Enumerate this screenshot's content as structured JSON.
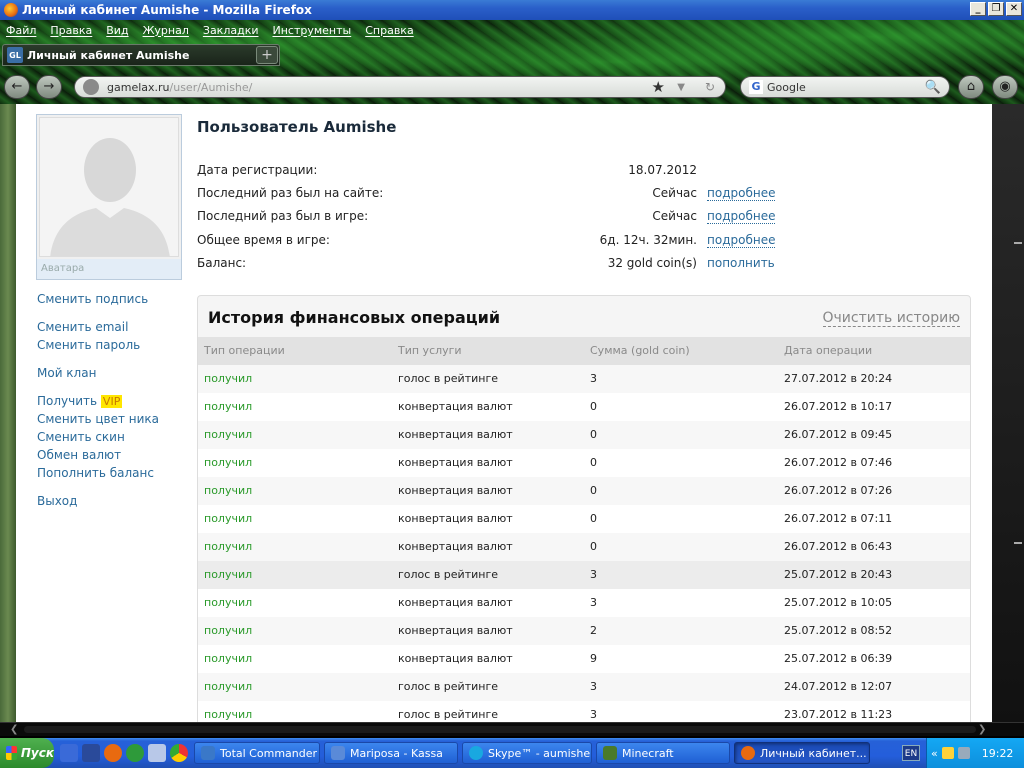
{
  "window": {
    "title": "Личный кабинет Aumishe - Mozilla Firefox",
    "controls": {
      "minimize": "_",
      "maximize": "❐",
      "close": "✕"
    }
  },
  "menu": [
    "Файл",
    "Правка",
    "Вид",
    "Журнал",
    "Закладки",
    "Инструменты",
    "Справка"
  ],
  "tab": {
    "icon_text": "GL",
    "title": "Личный кабинет Aumishe",
    "new_tab": "+"
  },
  "nav": {
    "back": "←",
    "forward": "→",
    "home": "⌂",
    "eye": "◉"
  },
  "url": {
    "host": "gamelax.ru",
    "path": "/user/Aumishe/",
    "star": "★",
    "drop": "▼",
    "reload": "↻"
  },
  "search": {
    "engine_icon": "G",
    "engine": "Google",
    "mag": "🔍"
  },
  "sidebar": {
    "avatar_caption": "Аватара",
    "links": {
      "change_signature": "Сменить подпись",
      "change_email": "Сменить email",
      "change_password": "Сменить пароль",
      "my_clan": "Мой клан",
      "get": "Получить",
      "vip": "VIP",
      "change_nick_color": "Сменить цвет ника",
      "change_skin": "Сменить скин",
      "currency_exchange": "Обмен валют",
      "top_up_balance": "Пополнить баланс",
      "logout": "Выход"
    }
  },
  "profile": {
    "title": "Пользователь Aumishe",
    "rows": {
      "reg_label": "Дата регистрации:",
      "reg_value": "18.07.2012",
      "site_label": "Последний раз был на сайте:",
      "site_value": "Сейчас",
      "site_more": "подробнее",
      "game_label": "Последний раз был в игре:",
      "game_value": "Сейчас",
      "game_more": "подробнее",
      "total_label": "Общее время в игре:",
      "total_value": "6д. 12ч. 32мин.",
      "total_more": "подробнее",
      "balance_label": "Баланс:",
      "balance_value": "32 gold coin(s)",
      "balance_topup": "пополнить"
    }
  },
  "history": {
    "title": "История финансовых операций",
    "clear": "Очистить историю",
    "columns": [
      "Тип операции",
      "Тип услуги",
      "Сумма (gold coin)",
      "Дата операции"
    ],
    "rows": [
      [
        "получил",
        "голос в рейтинге",
        "3",
        "27.07.2012 в 20:24"
      ],
      [
        "получил",
        "конвертация валют",
        "0",
        "26.07.2012 в 10:17"
      ],
      [
        "получил",
        "конвертация валют",
        "0",
        "26.07.2012 в 09:45"
      ],
      [
        "получил",
        "конвертация валют",
        "0",
        "26.07.2012 в 07:46"
      ],
      [
        "получил",
        "конвертация валют",
        "0",
        "26.07.2012 в 07:26"
      ],
      [
        "получил",
        "конвертация валют",
        "0",
        "26.07.2012 в 07:11"
      ],
      [
        "получил",
        "конвертация валют",
        "0",
        "26.07.2012 в 06:43"
      ],
      [
        "получил",
        "голос в рейтинге",
        "3",
        "25.07.2012 в 20:43"
      ],
      [
        "получил",
        "конвертация валют",
        "3",
        "25.07.2012 в 10:05"
      ],
      [
        "получил",
        "конвертация валют",
        "2",
        "25.07.2012 в 08:52"
      ],
      [
        "получил",
        "конвертация валют",
        "9",
        "25.07.2012 в 06:39"
      ],
      [
        "получил",
        "голос в рейтинге",
        "3",
        "24.07.2012 в 12:07"
      ],
      [
        "получил",
        "голос в рейтинге",
        "3",
        "23.07.2012 в 11:23"
      ]
    ]
  },
  "taskbar": {
    "start": "Пуск",
    "tasks": [
      {
        "label": "Total Commander ...",
        "color": "#3a78c8"
      },
      {
        "label": "Mariposa - Kassa",
        "color": "#5a8ad8"
      },
      {
        "label": "Skype™ - aumishe",
        "color": "#19a8e0"
      },
      {
        "label": "Minecraft",
        "color": "#4a7a2a"
      },
      {
        "label": "Личный кабинет...",
        "color": "#e86a10"
      }
    ],
    "lang": "EN",
    "tray_arrow": "«",
    "clock": "19:22"
  }
}
